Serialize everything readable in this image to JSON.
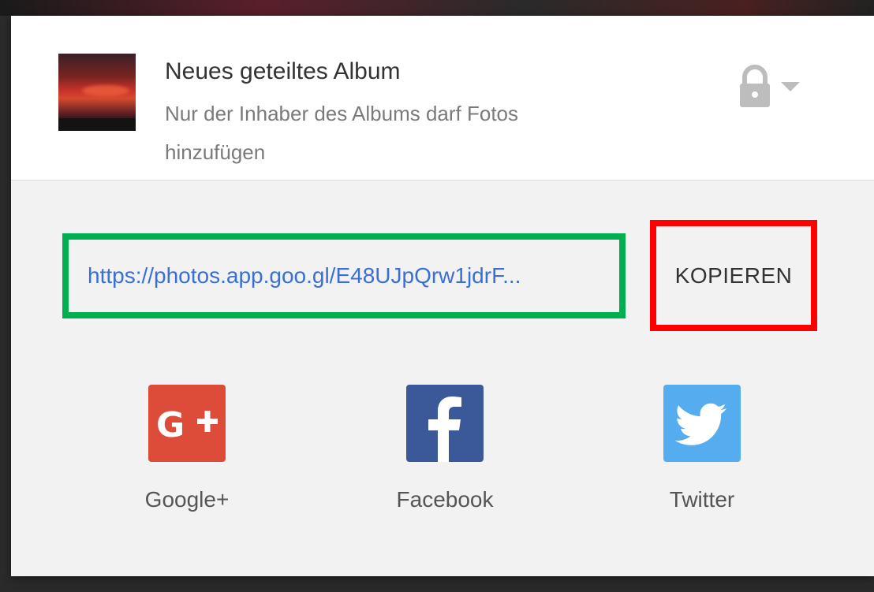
{
  "album": {
    "title": "Neues geteiltes Album",
    "subtitle": "Nur der Inhaber des Albums darf Fotos hinzufügen"
  },
  "share_link": {
    "url": "https://photos.app.goo.gl/E48UJpQrw1jdrF..."
  },
  "copy_label": "KOPIEREN",
  "social": [
    {
      "label": "Google+",
      "icon": "google-plus-icon",
      "color": "#dd4b39"
    },
    {
      "label": "Facebook",
      "icon": "facebook-icon",
      "color": "#3b5998"
    },
    {
      "label": "Twitter",
      "icon": "twitter-icon",
      "color": "#55acee"
    }
  ],
  "colors": {
    "highlight_link": "#00b050",
    "highlight_copy": "#ff0000",
    "link": "#3a6fd6"
  }
}
